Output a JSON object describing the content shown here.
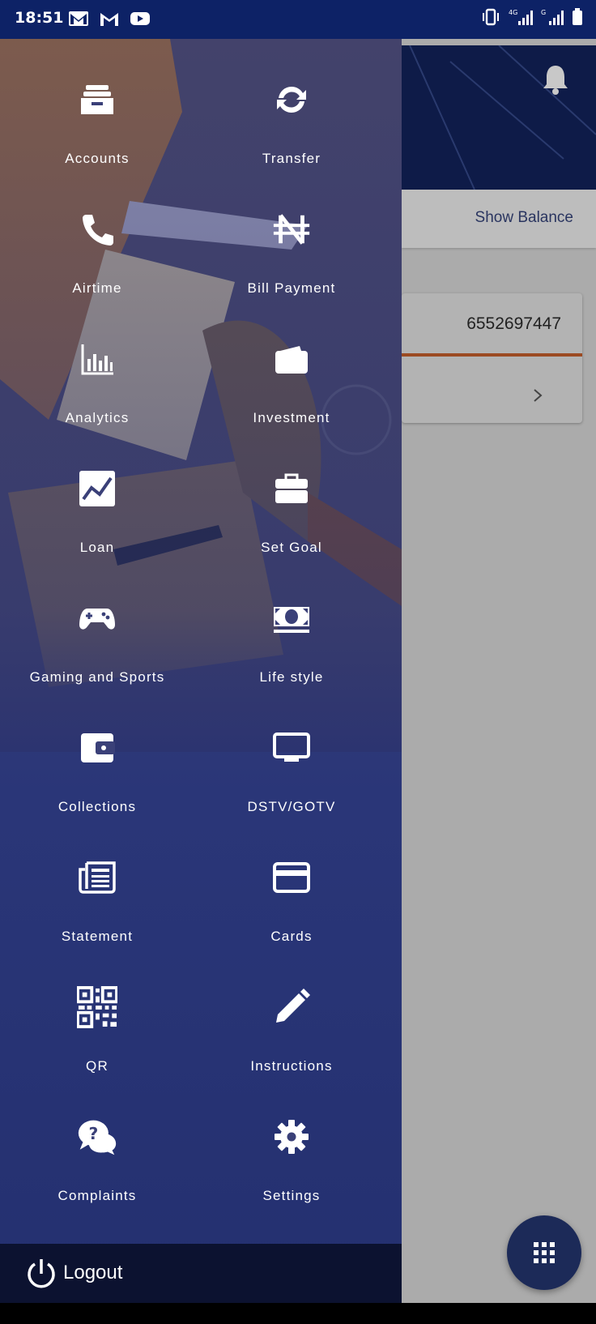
{
  "status_bar": {
    "time": "18:51",
    "left_icons": [
      "gmail-icon",
      "gmail-outline-icon",
      "youtube-icon"
    ],
    "right_icons": [
      "vibrate-icon",
      "signal-4g-icon",
      "signal-g-icon",
      "battery-icon"
    ],
    "network_label_1": "4G",
    "network_label_2": "G"
  },
  "background_app": {
    "show_balance_label": "Show Balance",
    "account_number": "6552697447",
    "accent_color": "#9c4a22"
  },
  "drawer": {
    "items": [
      {
        "label": "Accounts",
        "icon": "inbox-tray-icon"
      },
      {
        "label": "Transfer",
        "icon": "sync-icon"
      },
      {
        "label": "Airtime",
        "icon": "phone-icon"
      },
      {
        "label": "Bill Payment",
        "icon": "naira-icon"
      },
      {
        "label": "Analytics",
        "icon": "bar-chart-icon"
      },
      {
        "label": "Investment",
        "icon": "wallet-icon"
      },
      {
        "label": "Loan",
        "icon": "line-chart-icon"
      },
      {
        "label": "Set Goal",
        "icon": "briefcase-icon"
      },
      {
        "label": "Gaming and Sports",
        "icon": "gamepad-icon"
      },
      {
        "label": "Life style",
        "icon": "money-bill-icon"
      },
      {
        "label": "Collections",
        "icon": "wallet-card-icon"
      },
      {
        "label": "DSTV/GOTV",
        "icon": "tv-icon"
      },
      {
        "label": "Statement",
        "icon": "newspaper-icon"
      },
      {
        "label": "Cards",
        "icon": "credit-card-icon"
      },
      {
        "label": "QR",
        "icon": "qr-code-icon"
      },
      {
        "label": "Instructions",
        "icon": "pencil-icon"
      },
      {
        "label": "Complaints",
        "icon": "question-chat-icon"
      },
      {
        "label": "Settings",
        "icon": "gear-icon"
      }
    ],
    "logout_label": "Logout"
  }
}
